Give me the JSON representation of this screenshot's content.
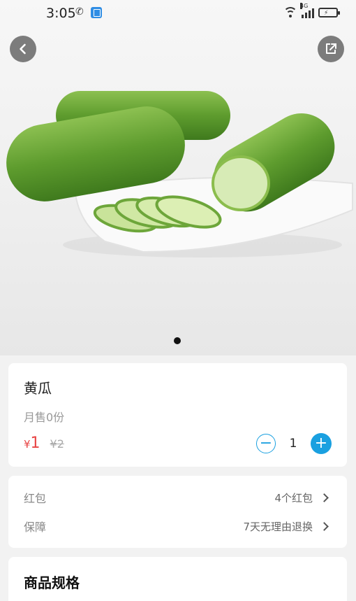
{
  "status_bar": {
    "time": "3:05",
    "network_label": "4G"
  },
  "product": {
    "name": "黄瓜",
    "monthly_sales": "月售0份",
    "currency_symbol": "¥",
    "price": "1",
    "original_price": "¥2",
    "quantity": "1"
  },
  "info_rows": [
    {
      "label": "红包",
      "value": "4个红包"
    },
    {
      "label": "保障",
      "value": "7天无理由退换"
    }
  ],
  "spec_section": {
    "title": "商品规格"
  },
  "carousel": {
    "current_page": 1,
    "total_pages": 1
  },
  "icons": [
    "back-icon",
    "share-icon",
    "minus-icon",
    "plus-icon",
    "chevron-right-icon",
    "wifi-icon",
    "signal-icon",
    "battery-icon"
  ],
  "colors": {
    "accent": "#1aa0e0",
    "price": "#e84545"
  }
}
